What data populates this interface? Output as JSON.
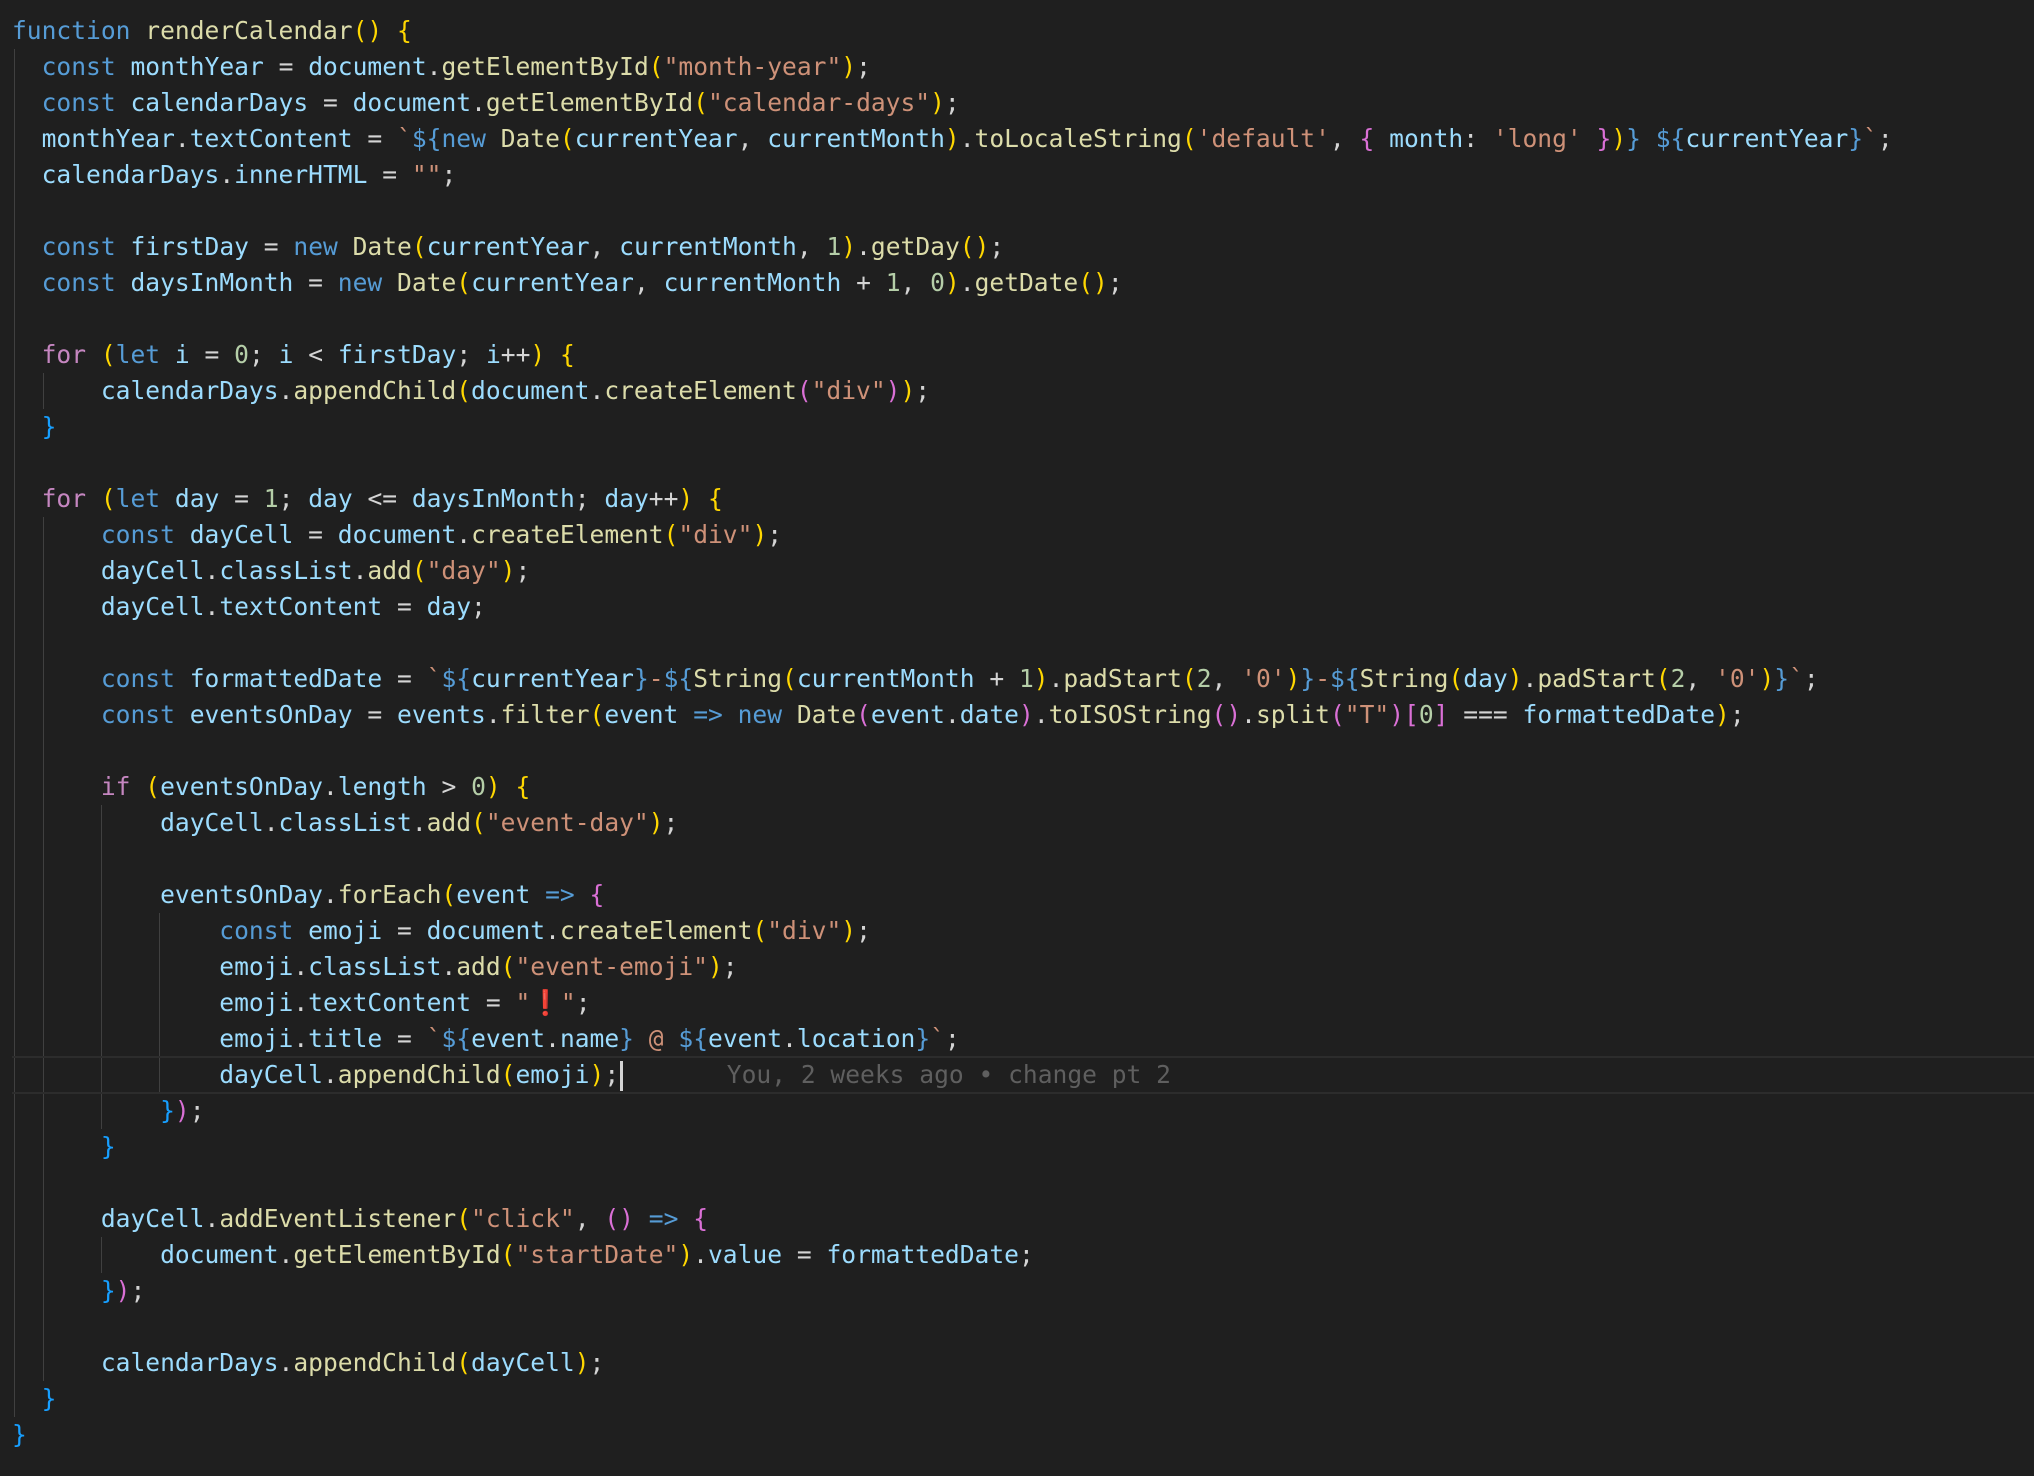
{
  "editor": {
    "theme": "dark",
    "colors": {
      "background": "#1f1f1f",
      "keyword": "#569cd6",
      "control": "#c586c0",
      "function": "#dcdcaa",
      "variable": "#9cdcfe",
      "string": "#ce9178",
      "number": "#b5cea8",
      "bracket_level_1": "#ffd700",
      "bracket_level_2": "#da70d6",
      "bracket_level_3": "#179fff"
    },
    "current_line": 30,
    "blame_annotation": "You, 2 weeks ago • change pt 2",
    "lines": [
      "function renderCalendar() {",
      "  const monthYear = document.getElementById(\"month-year\");",
      "  const calendarDays = document.getElementById(\"calendar-days\");",
      "  monthYear.textContent = `${new Date(currentYear, currentMonth).toLocaleString('default', { month: 'long' })} ${currentYear}`;",
      "  calendarDays.innerHTML = \"\";",
      "",
      "  const firstDay = new Date(currentYear, currentMonth, 1).getDay();",
      "  const daysInMonth = new Date(currentYear, currentMonth + 1, 0).getDate();",
      "",
      "  for (let i = 0; i < firstDay; i++) {",
      "      calendarDays.appendChild(document.createElement(\"div\"));",
      "  }",
      "",
      "  for (let day = 1; day <= daysInMonth; day++) {",
      "      const dayCell = document.createElement(\"div\");",
      "      dayCell.classList.add(\"day\");",
      "      dayCell.textContent = day;",
      "",
      "      const formattedDate = `${currentYear}-${String(currentMonth + 1).padStart(2, '0')}-${String(day).padStart(2, '0')}`;",
      "      const eventsOnDay = events.filter(event => new Date(event.date).toISOString().split(\"T\")[0] === formattedDate);",
      "",
      "      if (eventsOnDay.length > 0) {",
      "          dayCell.classList.add(\"event-day\");",
      "",
      "          eventsOnDay.forEach(event => {",
      "              const emoji = document.createElement(\"div\");",
      "              emoji.classList.add(\"event-emoji\");",
      "              emoji.textContent = \"❗\";",
      "              emoji.title = `${event.name} @ ${event.location}`;",
      "              dayCell.appendChild(emoji);",
      "          });",
      "      }",
      "",
      "      dayCell.addEventListener(\"click\", () => {",
      "          document.getElementById(\"startDate\").value = formattedDate;",
      "      });",
      "",
      "      calendarDays.appendChild(dayCell);",
      "  }",
      "}"
    ]
  }
}
